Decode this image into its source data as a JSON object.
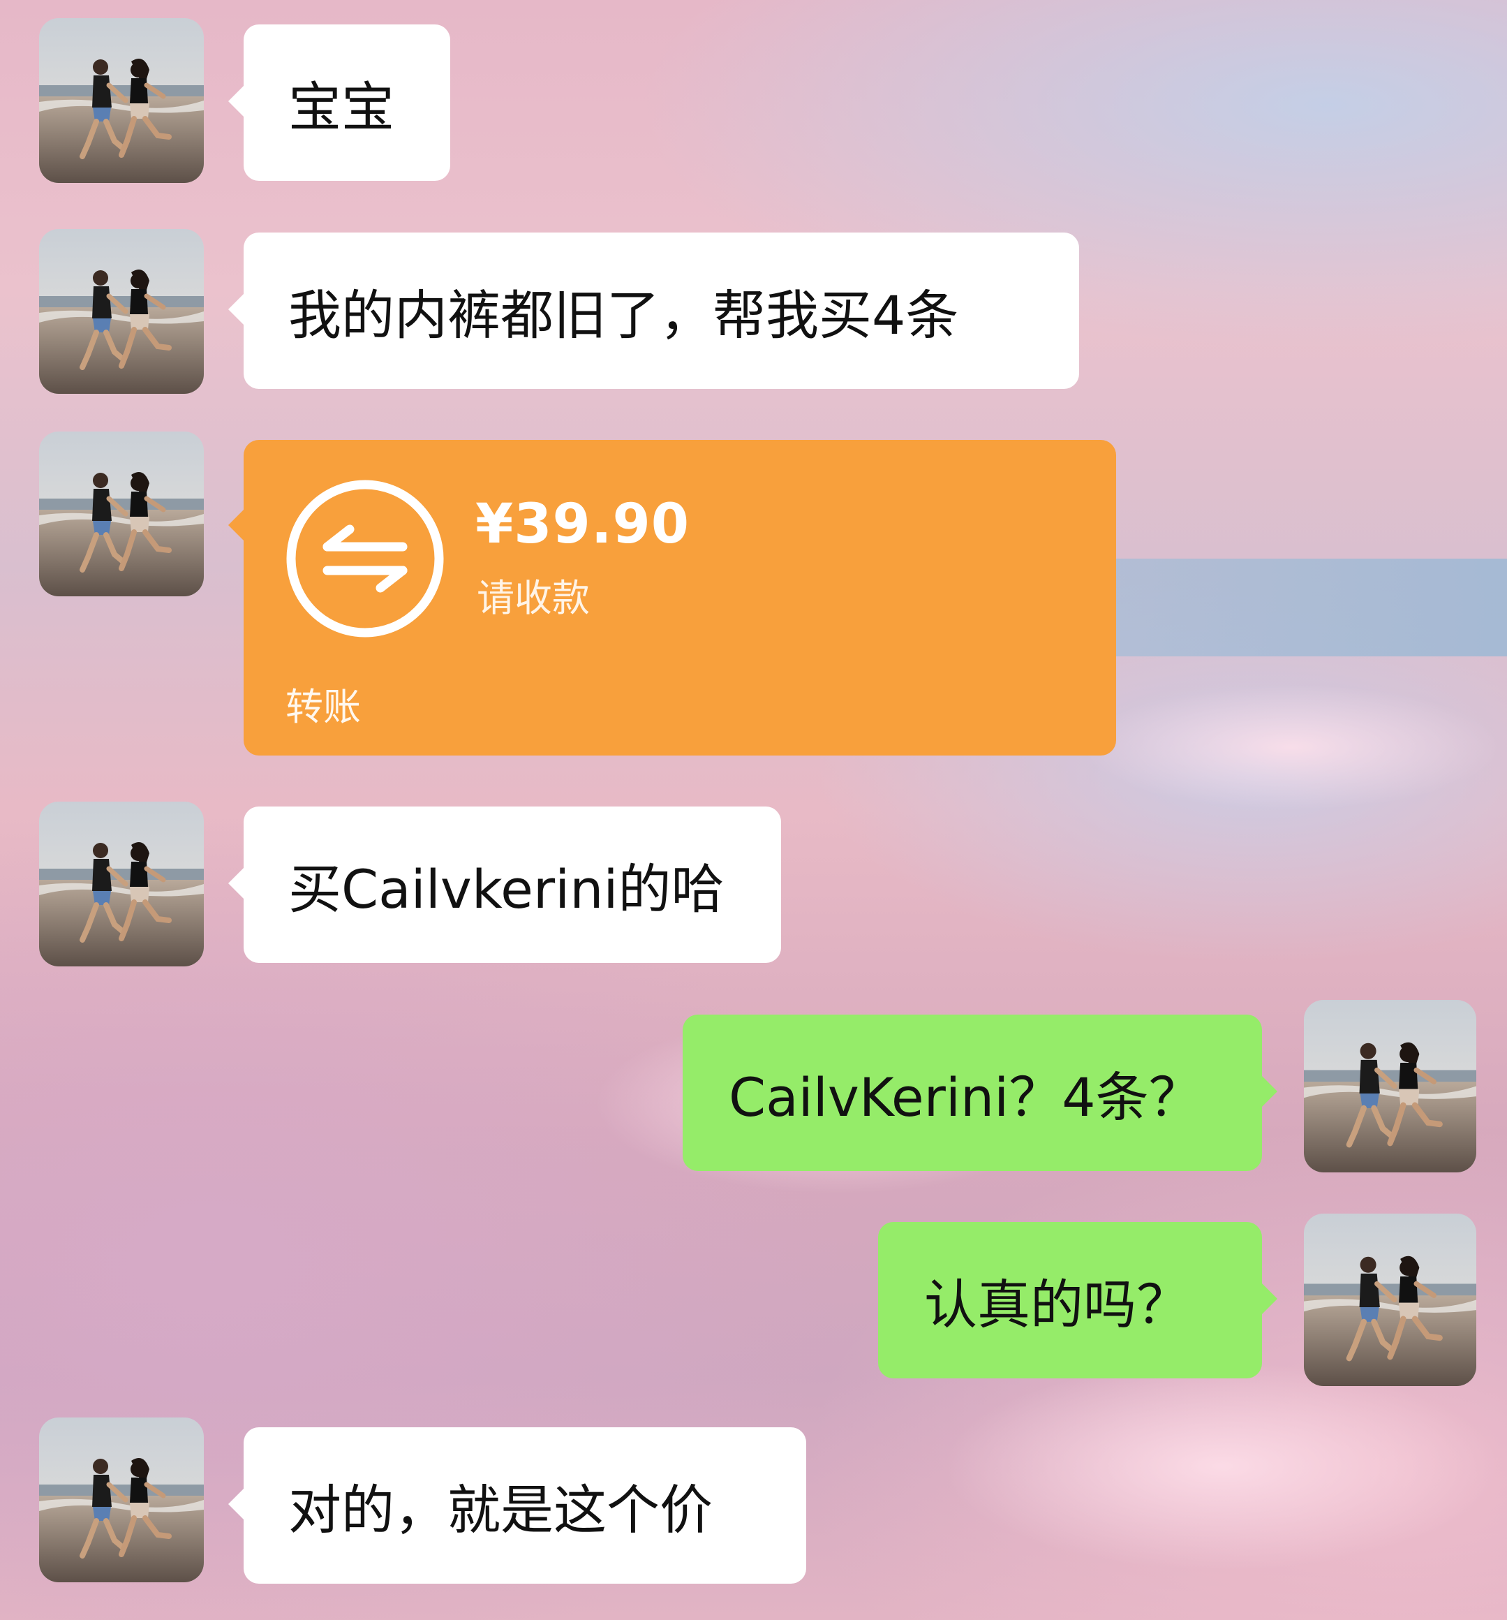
{
  "messages": [
    {
      "sender": "other",
      "type": "text",
      "text": "宝宝"
    },
    {
      "sender": "other",
      "type": "text",
      "text": "我的内裤都旧了，帮我买4条"
    },
    {
      "sender": "other",
      "type": "transfer",
      "amount": "¥39.90",
      "note": "请收款",
      "footer": "转账"
    },
    {
      "sender": "other",
      "type": "text",
      "text": "买Cailvkerini的哈"
    },
    {
      "sender": "me",
      "type": "text",
      "text": "CailvKerini？4条？"
    },
    {
      "sender": "me",
      "type": "text",
      "text": "认真的吗？"
    },
    {
      "sender": "other",
      "type": "text",
      "text": "对的，就是这个价"
    }
  ],
  "colors": {
    "incoming_bubble": "#ffffff",
    "outgoing_bubble": "#95ec69",
    "transfer_card": "#f8a03c"
  },
  "avatar_icon": "couple-running-on-beach-photo",
  "transfer_icon": "transfer-arrows-icon"
}
